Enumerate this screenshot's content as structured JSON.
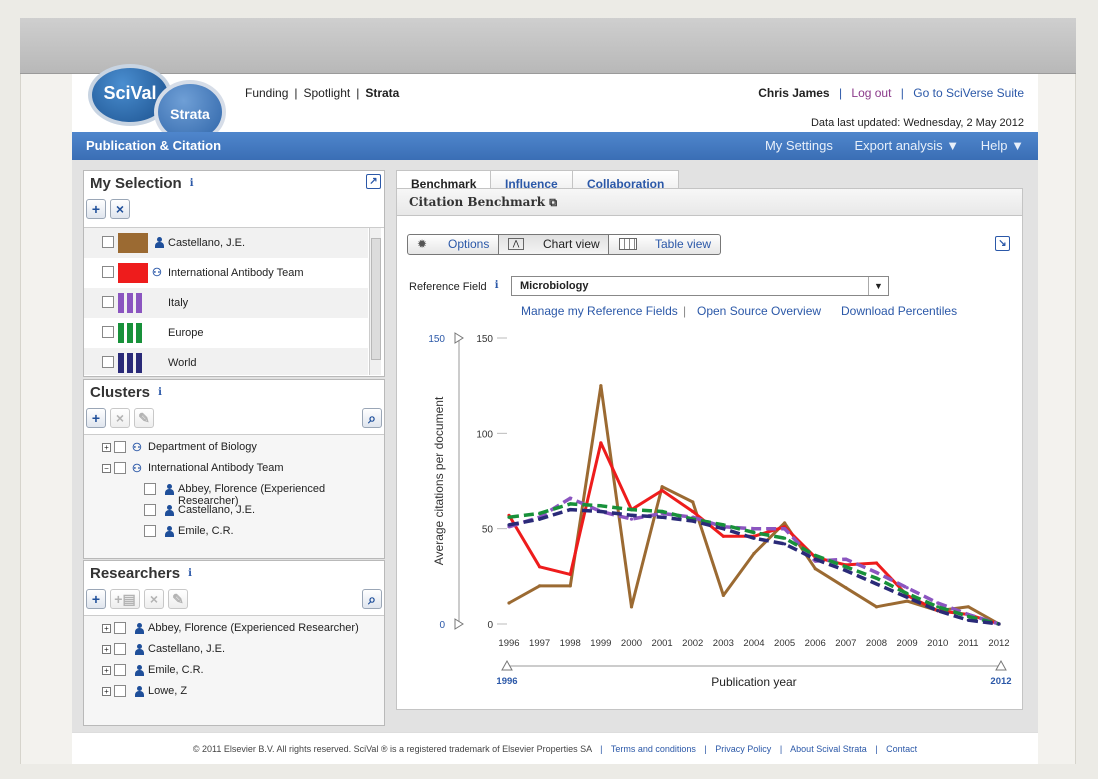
{
  "header": {
    "logo_main": "SciVal",
    "logo_sub": "Strata",
    "nav": [
      "Funding",
      "Spotlight",
      "Strata"
    ],
    "nav_sep": "|",
    "user": "Chris James",
    "logout": "Log out",
    "suite": "Go to SciVerse Suite",
    "updated": "Data last updated: Wednesday, 2 May 2012"
  },
  "bluebar": {
    "title": "Publication & Citation",
    "settings": "My Settings",
    "export": "Export analysis ▼",
    "help": "Help ▼"
  },
  "selection": {
    "title": "My Selection",
    "items": [
      {
        "label": "Castellano, J.E.",
        "color": "#9b6a32",
        "kind": "person"
      },
      {
        "label": "International Antibody Team",
        "color": "#ee1c1c",
        "kind": "group"
      },
      {
        "label": "Italy",
        "color": "#8b55c0",
        "kind": "stripes"
      },
      {
        "label": "Europe",
        "color": "#18913a",
        "kind": "stripes"
      },
      {
        "label": "World",
        "color": "#2a2a78",
        "kind": "stripes"
      }
    ]
  },
  "clusters": {
    "title": "Clusters",
    "items": [
      {
        "label": "Department of Biology",
        "kind": "group",
        "expander": "+",
        "indent": 0
      },
      {
        "label": "International Antibody Team",
        "kind": "group",
        "expander": "−",
        "indent": 0
      },
      {
        "label": "Abbey, Florence (Experienced Researcher)",
        "kind": "person",
        "expander": "",
        "indent": 1
      },
      {
        "label": "Castellano, J.E.",
        "kind": "person",
        "expander": "",
        "indent": 1
      },
      {
        "label": "Emile, C.R.",
        "kind": "person",
        "expander": "",
        "indent": 1
      }
    ]
  },
  "researchers": {
    "title": "Researchers",
    "items": [
      {
        "label": "Abbey, Florence (Experienced Researcher)"
      },
      {
        "label": "Castellano, J.E."
      },
      {
        "label": "Emile, C.R."
      },
      {
        "label": "Lowe, Z"
      }
    ]
  },
  "tabs": [
    "Benchmark",
    "Influence",
    "Collaboration"
  ],
  "subhead": "Citation Benchmark",
  "view": {
    "options": "Options",
    "chart": "Chart view",
    "table": "Table view"
  },
  "reference": {
    "label": "Reference Field",
    "value": "Microbiology",
    "links": [
      "Manage my Reference Fields",
      "Open Source Overview",
      "Download Percentiles"
    ]
  },
  "chart_data": {
    "type": "line",
    "xlabel": "Publication year",
    "ylabel": "Average citations per document",
    "ylim": [
      0,
      150
    ],
    "yticks": [
      0,
      50,
      100,
      150
    ],
    "slider_min": "0",
    "slider_max": "150",
    "x_range_start": "1996",
    "x_range_end": "2012",
    "x": [
      "1996",
      "1997",
      "1998",
      "1999",
      "2000",
      "2001",
      "2002",
      "2003",
      "2004",
      "2005",
      "2006",
      "2007",
      "2008",
      "2009",
      "2010",
      "2011",
      "2012"
    ],
    "series": [
      {
        "color": "#9b6a32",
        "dash": false,
        "values": [
          11,
          20,
          20,
          125,
          9,
          72,
          64,
          15,
          37,
          53,
          29,
          19,
          9,
          12,
          7,
          9,
          0
        ]
      },
      {
        "color": "#ee1c1c",
        "dash": false,
        "values": [
          57,
          30,
          26,
          95,
          60,
          70,
          59,
          46,
          46,
          51,
          35,
          31,
          32,
          15,
          7,
          5,
          0
        ]
      },
      {
        "color": "#8b55c0",
        "dash": true,
        "values": [
          51,
          56,
          66,
          59,
          55,
          58,
          56,
          51,
          50,
          50,
          33,
          34,
          27,
          19,
          11,
          5,
          0
        ]
      },
      {
        "color": "#18913a",
        "dash": true,
        "values": [
          56,
          58,
          63,
          62,
          60,
          59,
          55,
          52,
          48,
          45,
          36,
          30,
          24,
          16,
          9,
          4,
          0
        ]
      },
      {
        "color": "#2a2a78",
        "dash": true,
        "values": [
          52,
          55,
          60,
          59,
          57,
          56,
          54,
          50,
          45,
          42,
          34,
          28,
          21,
          14,
          7,
          2,
          0
        ]
      }
    ]
  },
  "footer": {
    "copy": "© 2011 Elsevier B.V. All rights reserved. SciVal ® is a registered trademark of Elsevier Properties SA",
    "links": [
      "Terms and conditions",
      "Privacy Policy",
      "About Scival Strata",
      "Contact"
    ]
  }
}
